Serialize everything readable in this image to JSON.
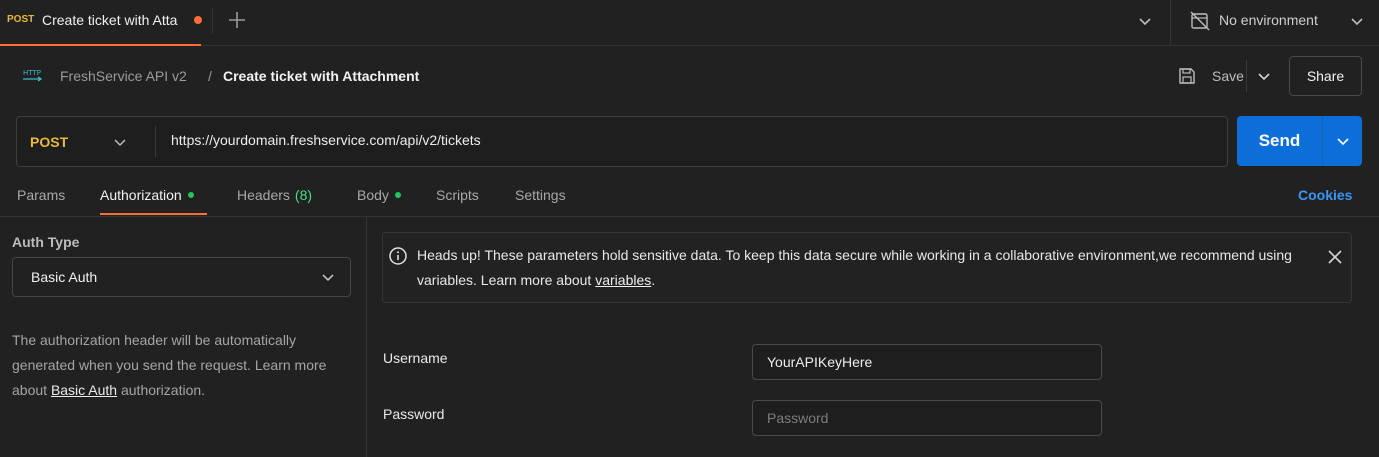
{
  "colors": {
    "accent": "#ff6c37",
    "method_post": "#e8b93c",
    "send_button": "#0c6fd9",
    "link_blue": "#3b95f5",
    "status_green": "#22c55e"
  },
  "tabbar": {
    "tab": {
      "method": "POST",
      "title": "Create ticket with Atta",
      "unsaved": true
    },
    "new_tab_icon": "plus-icon",
    "environment": {
      "label": "No environment",
      "icon": "no-environment-icon"
    }
  },
  "header": {
    "collection": "FreshService API v2",
    "separator": "/",
    "request_name": "Create ticket with Attachment",
    "save_label": "Save",
    "share_label": "Share"
  },
  "request": {
    "method": "POST",
    "url": "https://yourdomain.freshservice.com/api/v2/tickets",
    "send_label": "Send"
  },
  "request_tabs": {
    "params": "Params",
    "authorization": "Authorization",
    "headers": "Headers",
    "headers_count": "(8)",
    "body": "Body",
    "scripts": "Scripts",
    "settings": "Settings",
    "cookies": "Cookies"
  },
  "auth": {
    "type_label": "Auth Type",
    "type_value": "Basic Auth",
    "desc_before": "The authorization header will be automatically generated when you send the request. Learn more about ",
    "desc_link": "Basic Auth",
    "desc_after": " authorization."
  },
  "banner": {
    "text_before": "Heads up! These parameters hold sensitive data. To keep this data secure while working in a collaborative environment,we recommend using variables. Learn more about ",
    "link": "variables",
    "text_after": "."
  },
  "form": {
    "username_label": "Username",
    "username_value": "YourAPIKeyHere",
    "password_label": "Password",
    "password_placeholder": "Password"
  }
}
